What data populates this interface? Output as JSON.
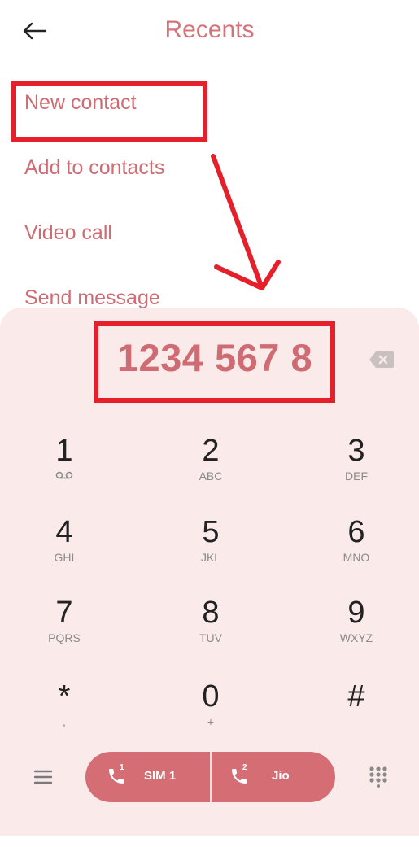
{
  "header": {
    "title": "Recents",
    "back_icon": "arrow-left-icon"
  },
  "menu": {
    "items": [
      {
        "label": "New contact"
      },
      {
        "label": "Add to contacts"
      },
      {
        "label": "Video call"
      },
      {
        "label": "Send message"
      }
    ]
  },
  "dialer": {
    "number": "1234 567 8",
    "keys": [
      {
        "digit": "1",
        "sub": "ꝏ"
      },
      {
        "digit": "2",
        "sub": "ABC"
      },
      {
        "digit": "3",
        "sub": "DEF"
      },
      {
        "digit": "4",
        "sub": "GHI"
      },
      {
        "digit": "5",
        "sub": "JKL"
      },
      {
        "digit": "6",
        "sub": "MNO"
      },
      {
        "digit": "7",
        "sub": "PQRS"
      },
      {
        "digit": "8",
        "sub": "TUV"
      },
      {
        "digit": "9",
        "sub": "WXYZ"
      },
      {
        "digit": "*",
        "sub": ","
      },
      {
        "digit": "0",
        "sub": "+"
      },
      {
        "digit": "#",
        "sub": ""
      }
    ]
  },
  "bottom": {
    "sim1_label": "SIM 1",
    "sim1_badge": "1",
    "sim2_label": "Jio",
    "sim2_badge": "2"
  },
  "colors": {
    "accent": "#d46d74",
    "panel": "#fbeaea",
    "highlight": "#e5202a"
  }
}
